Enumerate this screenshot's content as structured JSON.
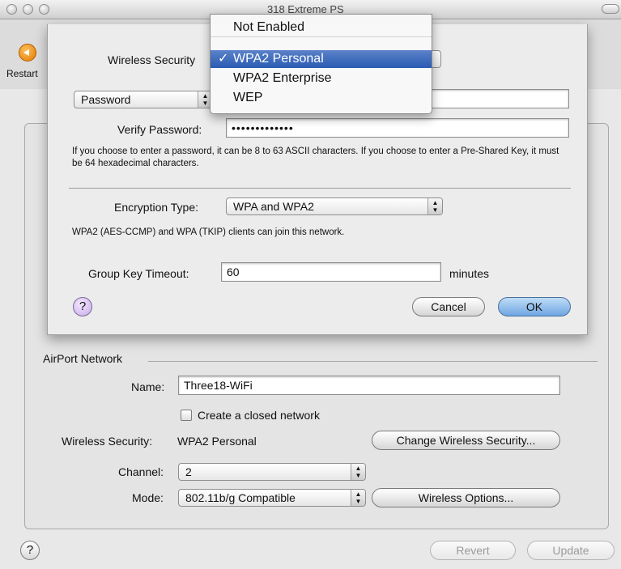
{
  "window": {
    "title": "318 Extreme PS"
  },
  "toolbar": {
    "restart_label": "Restart"
  },
  "airport": {
    "section_label": "AirPort Network",
    "name_label": "Name:",
    "name_value": "Three18-WiFi",
    "closed_network_label": "Create a closed network",
    "security_label": "Wireless Security:",
    "security_value": "WPA2 Personal",
    "change_security_button": "Change Wireless Security...",
    "channel_label": "Channel:",
    "channel_value": "2",
    "mode_label": "Mode:",
    "mode_value": "802.11b/g Compatible",
    "wireless_options_button": "Wireless Options..."
  },
  "footer": {
    "revert_button": "Revert",
    "update_button": "Update"
  },
  "sheet": {
    "security_label": "Wireless Security",
    "password_type": "Password",
    "verify_label": "Verify Password:",
    "verify_value": "•••••••••••••",
    "password_info": "If you choose to enter a password, it can be 8 to 63 ASCII characters. If you choose to enter a Pre-Shared Key, it must be 64 hexadecimal characters.",
    "encryption_label": "Encryption Type:",
    "encryption_value": "WPA and WPA2",
    "encryption_info": "WPA2 (AES-CCMP) and WPA (TKIP) clients can join this network.",
    "group_key_label": "Group Key Timeout:",
    "group_key_value": "60",
    "group_key_units": "minutes",
    "cancel_button": "Cancel",
    "ok_button": "OK"
  },
  "menu": {
    "items": [
      "Not Enabled",
      "WPA2 Personal",
      "WPA2 Enterprise",
      "WEP"
    ],
    "selected_index": 1,
    "check_mark": "✓"
  }
}
